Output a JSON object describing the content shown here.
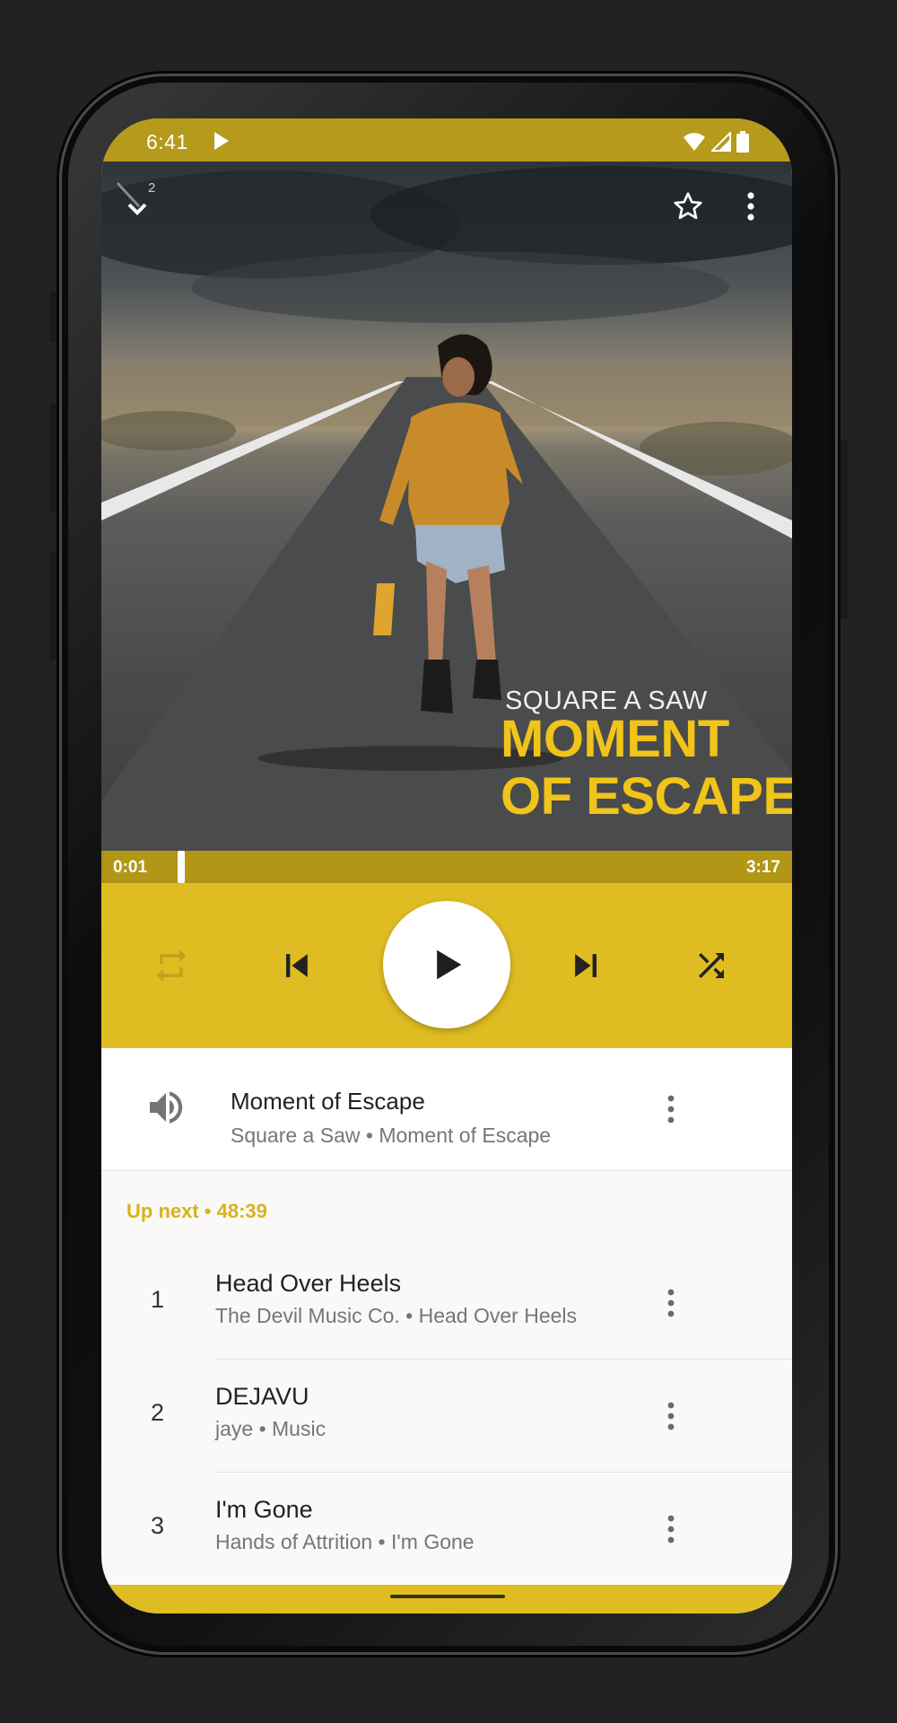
{
  "status_bar": {
    "time": "6:41",
    "icons": [
      "play-icon",
      "wifi-icon",
      "signal-icon",
      "battery-icon"
    ]
  },
  "album_art": {
    "artist_text": "SQUARE A SAW",
    "title_line1": "MOMENT",
    "title_line2": "OF ESCAPE",
    "collapse_badge": "2"
  },
  "progress": {
    "elapsed": "0:01",
    "total": "3:17",
    "fraction": 0.005
  },
  "controls": {
    "icons": [
      "repeat-icon",
      "skip-previous-icon",
      "play-icon",
      "skip-next-icon",
      "shuffle-icon"
    ]
  },
  "now_playing": {
    "title": "Moment of Escape",
    "subtitle": "Square a Saw  •  Moment of Escape"
  },
  "up_next": {
    "label": "Up next  •  48:39"
  },
  "queue": [
    {
      "number": "1",
      "title": "Head Over Heels",
      "subtitle": "The Devil Music Co.  •  Head Over Heels"
    },
    {
      "number": "2",
      "title": "DEJAVU",
      "subtitle": "jaye  •  Music"
    },
    {
      "number": "3",
      "title": "I'm Gone",
      "subtitle": "Hands of Attrition  •  I'm Gone"
    }
  ],
  "colors": {
    "accent": "#dfbd22",
    "status_bar": "#b69a1b",
    "progress_bar": "#b29616",
    "art_title": "#f0c419",
    "up_next_text": "#d8b318"
  }
}
